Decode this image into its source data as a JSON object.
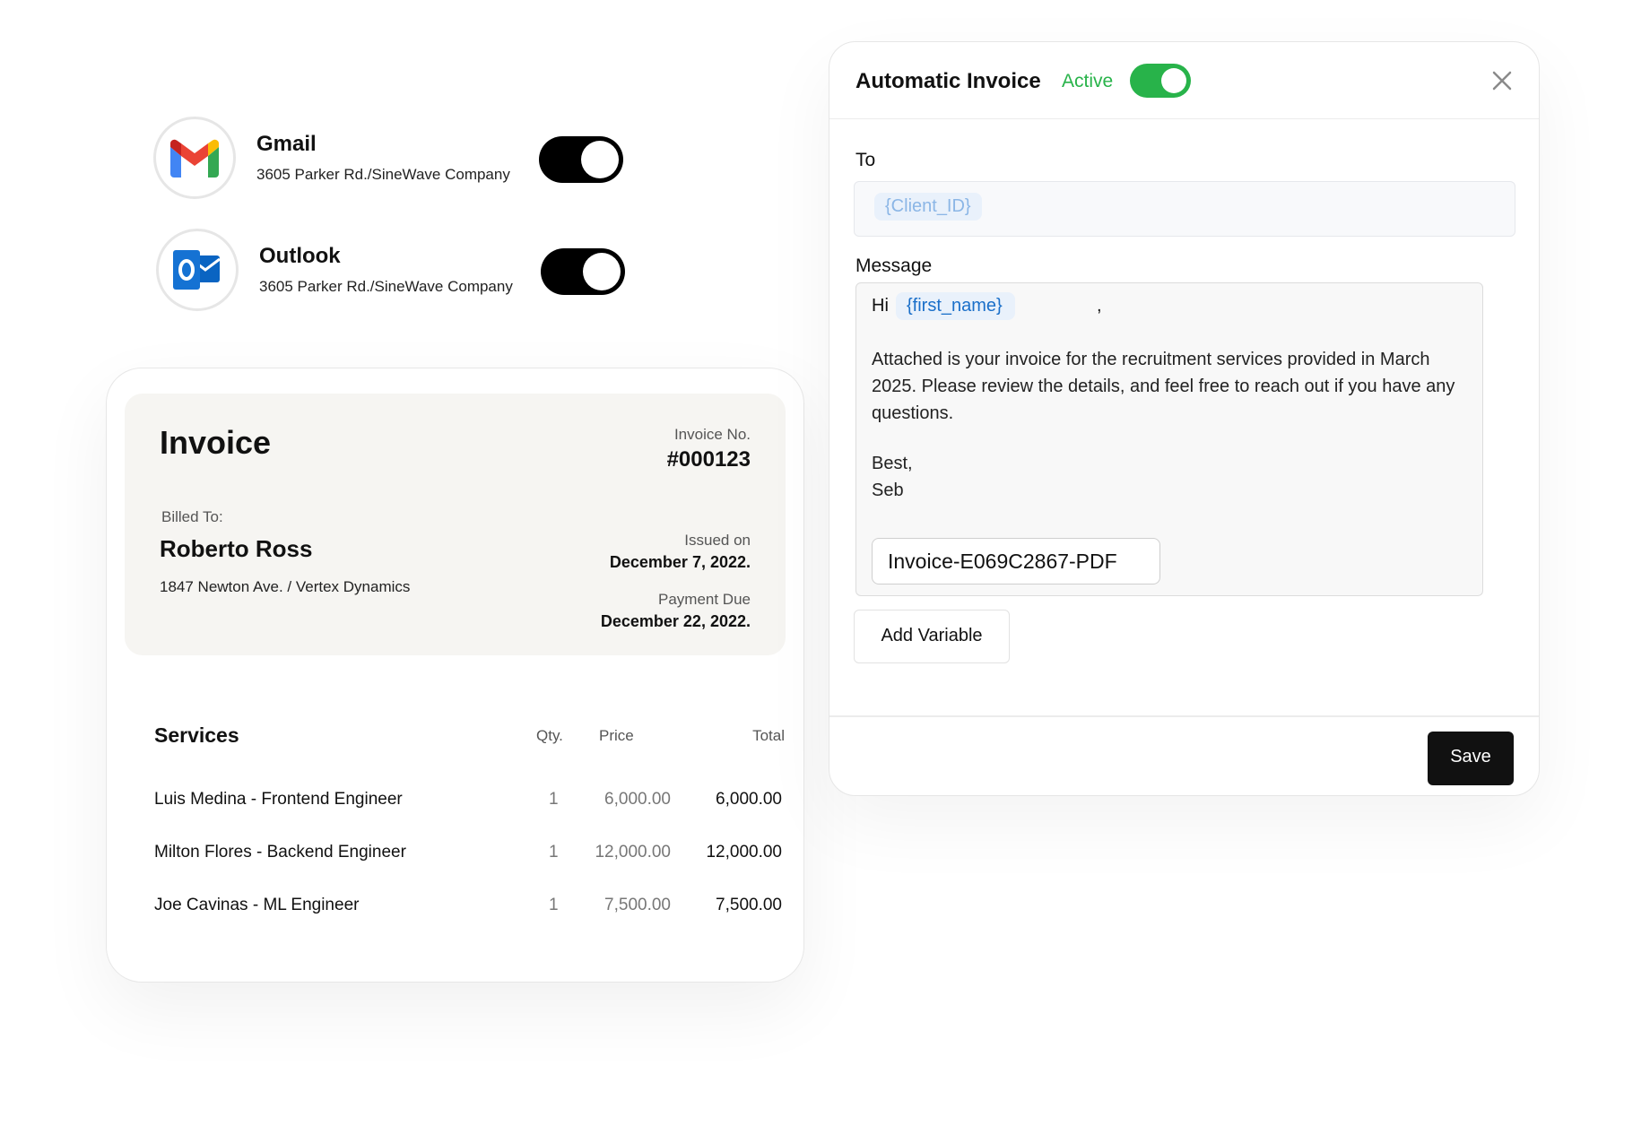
{
  "integrations": [
    {
      "name": "Gmail",
      "address": "3605 Parker Rd./SineWave Company",
      "enabled": true,
      "icon": "gmail-icon"
    },
    {
      "name": "Outlook",
      "address": "3605 Parker Rd./SineWave Company",
      "enabled": true,
      "icon": "outlook-icon"
    }
  ],
  "invoice": {
    "title": "Invoice",
    "number_label": "Invoice No.",
    "number": "#000123",
    "billed_to_label": "Billed To:",
    "billed_to_name": "Roberto Ross",
    "billed_to_address": "1847 Newton Ave. / Vertex Dynamics",
    "issued_label": "Issued on",
    "issued_date": "December 7, 2022.",
    "due_label": "Payment Due",
    "due_date": "December 22, 2022.",
    "services_title": "Services",
    "columns": {
      "qty": "Qty.",
      "price": "Price",
      "total": "Total"
    },
    "rows": [
      {
        "name": "Luis Medina - Frontend Engineer",
        "qty": "1",
        "price": "6,000.00",
        "total": "6,000.00"
      },
      {
        "name": "Milton Flores - Backend Engineer",
        "qty": "1",
        "price": "12,000.00",
        "total": "12,000.00"
      },
      {
        "name": "Joe Cavinas - ML Engineer",
        "qty": "1",
        "price": "7,500.00",
        "total": "7,500.00"
      }
    ]
  },
  "auto_invoice": {
    "title": "Automatic Invoice",
    "status": "Active",
    "to_label": "To",
    "to_value": "{Client_ID}",
    "message_label": "Message",
    "greeting": "Hi",
    "greeting_var": "{first_name}",
    "greeting_punct": ",",
    "body": "Attached is your invoice for the recruitment services provided in March 2025. Please review the details, and feel free to reach out if you have any questions.",
    "sign_off": "Best,",
    "signature": "Seb",
    "attachment": "Invoice-E069C2867-PDF",
    "add_variable_label": "Add Variable",
    "save_label": "Save"
  },
  "colors": {
    "active_green": "#28b34a",
    "variable_blue": "#1a6fc9",
    "chip_bg": "#e9f1fb"
  }
}
